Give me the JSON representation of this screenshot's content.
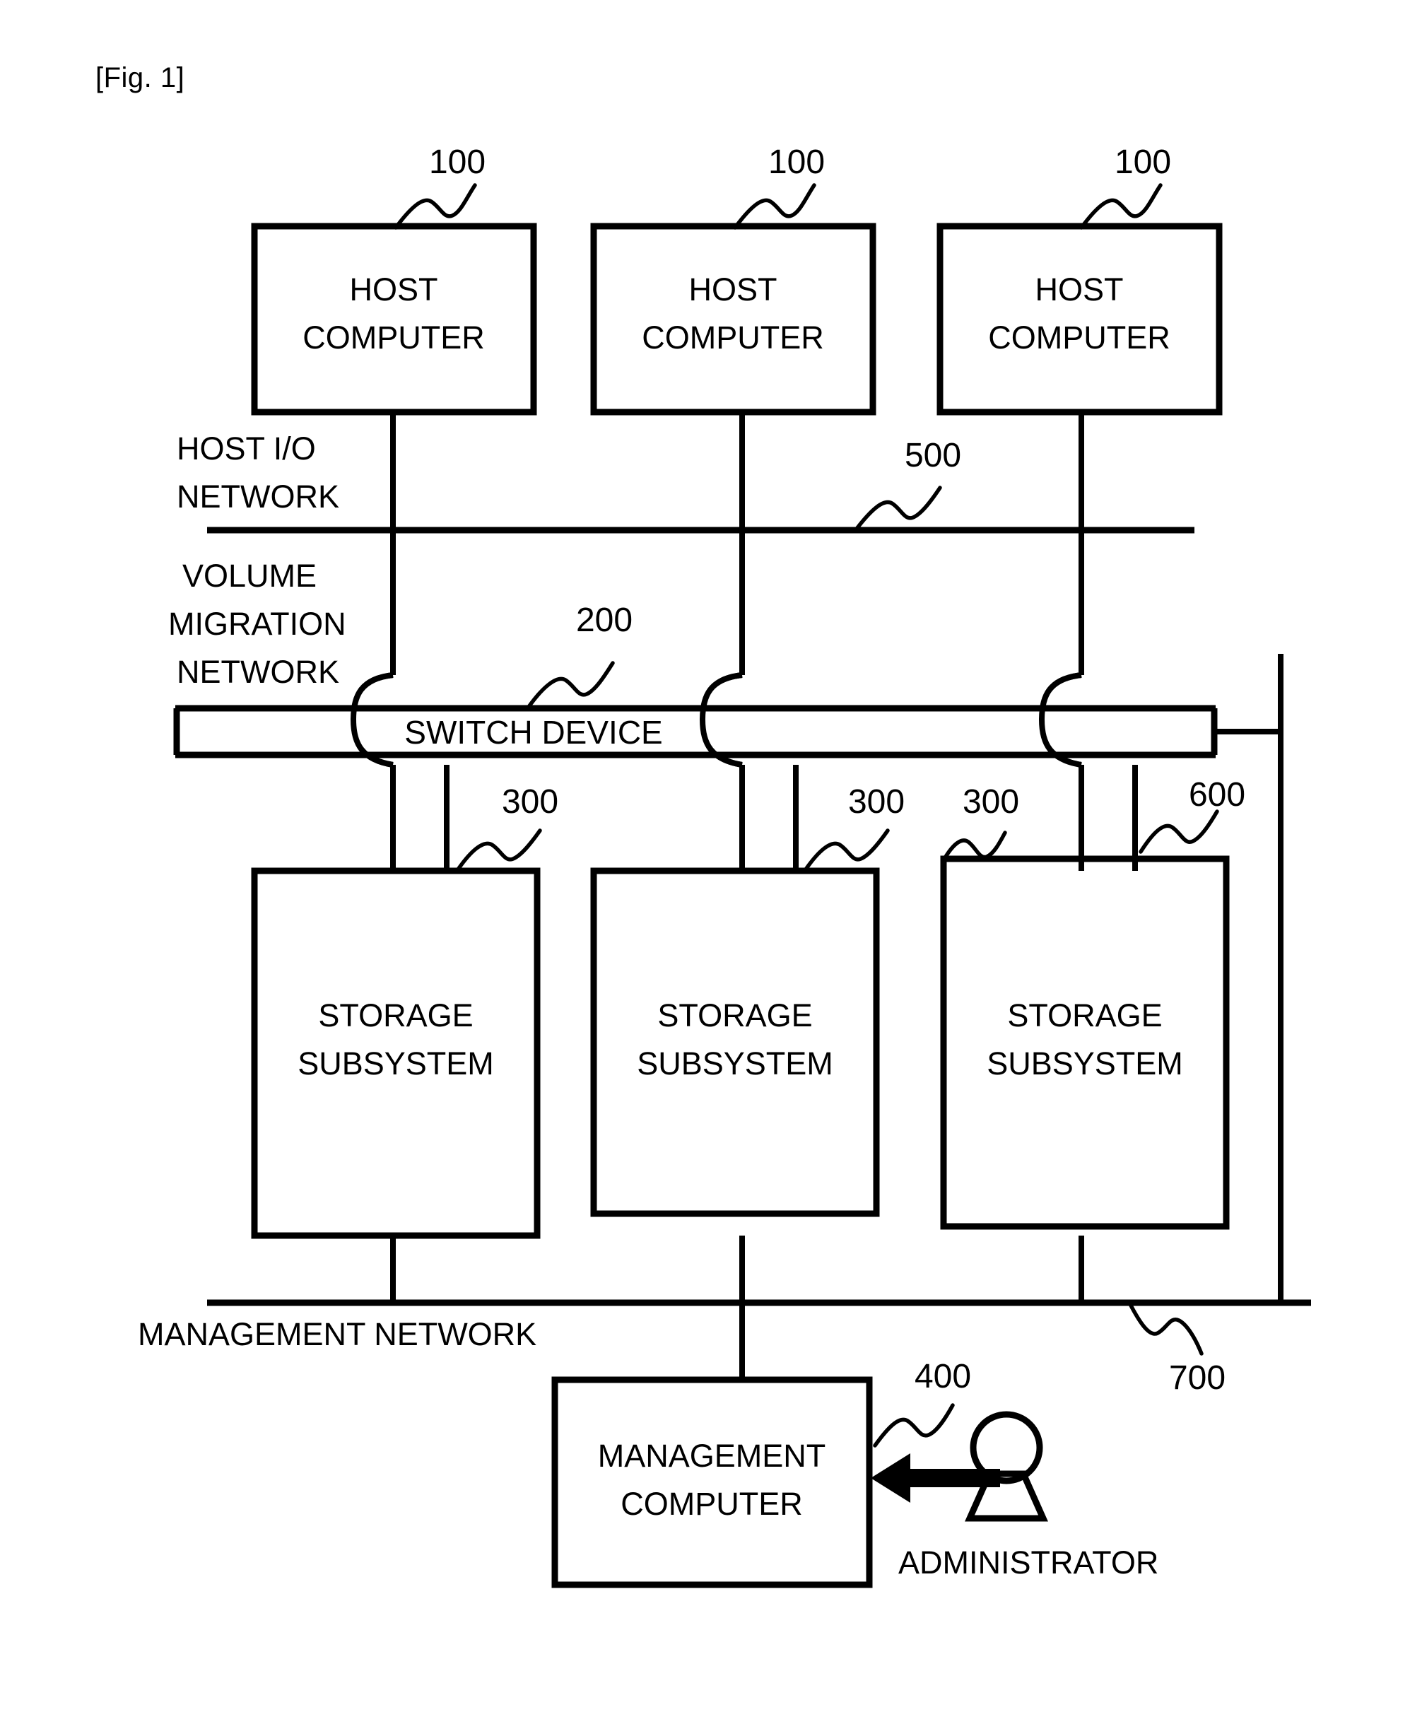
{
  "figure": {
    "label": "[Fig. 1]"
  },
  "hosts": [
    {
      "line1": "HOST",
      "line2": "COMPUTER",
      "ref": "100"
    },
    {
      "line1": "HOST",
      "line2": "COMPUTER",
      "ref": "100"
    },
    {
      "line1": "HOST",
      "line2": "COMPUTER",
      "ref": "100"
    }
  ],
  "storages": [
    {
      "line1": "STORAGE",
      "line2": "SUBSYSTEM",
      "ref": "300"
    },
    {
      "line1": "STORAGE",
      "line2": "SUBSYSTEM",
      "ref": "300"
    },
    {
      "line1": "STORAGE",
      "line2": "SUBSYSTEM",
      "ref": "300"
    }
  ],
  "networks": {
    "host_io": {
      "line1": "HOST I/O",
      "line2": "NETWORK",
      "ref": "500"
    },
    "volume_migration": {
      "line1": "VOLUME",
      "line2": "MIGRATION",
      "line3": "NETWORK",
      "ref": "600"
    },
    "management": {
      "label": "MANAGEMENT NETWORK",
      "ref": "700"
    }
  },
  "switch": {
    "label": "SWITCH DEVICE",
    "ref": "200"
  },
  "management_computer": {
    "line1": "MANAGEMENT",
    "line2": "COMPUTER",
    "ref": "400"
  },
  "administrator": {
    "label": "ADMINISTRATOR"
  },
  "colors": {
    "ink": "#000000",
    "paper": "#ffffff"
  }
}
